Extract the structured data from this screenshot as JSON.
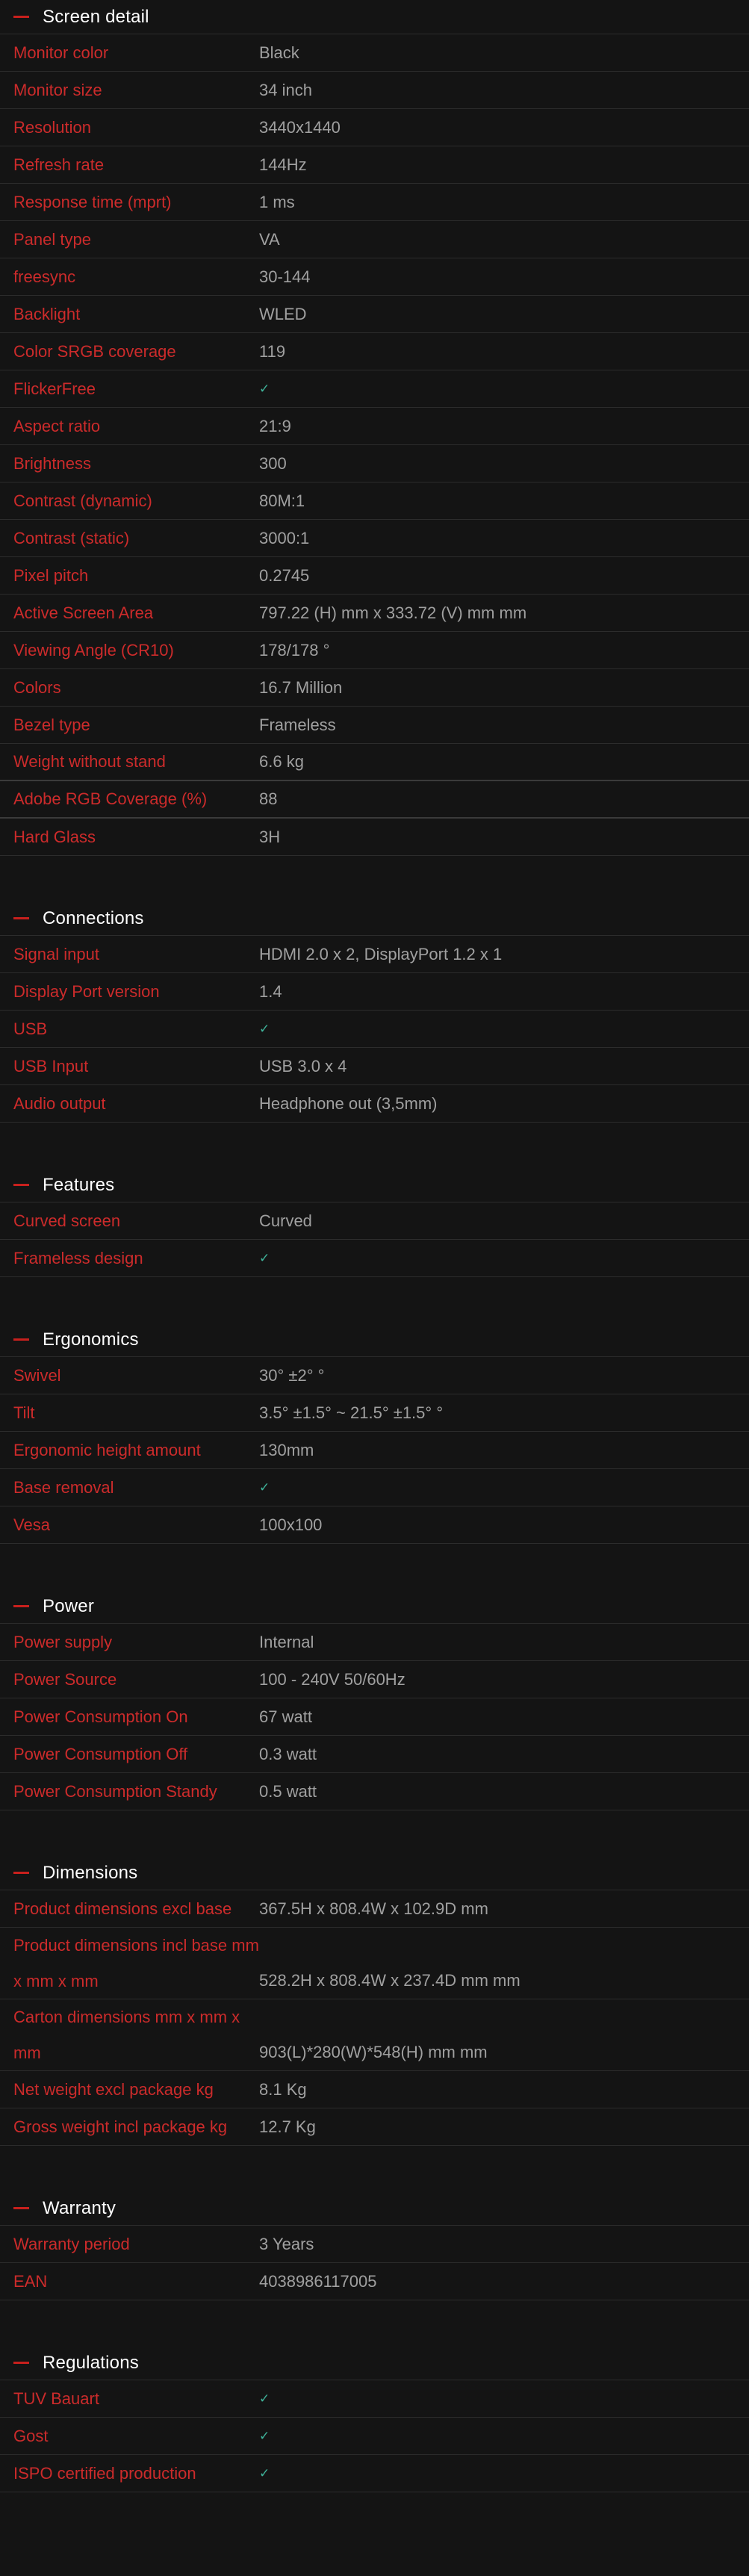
{
  "check_symbol": "✓",
  "colors": {
    "background": "#141414",
    "label": "#cc2b2b",
    "value": "#a0a0a0",
    "check": "#3fb39a",
    "accent_dash": "#c8201d"
  },
  "sections": [
    {
      "title": "Screen detail",
      "rows": [
        {
          "label": "Monitor color",
          "value": "Black"
        },
        {
          "label": "Monitor size",
          "value": "34 inch"
        },
        {
          "label": "Resolution",
          "value": "3440x1440"
        },
        {
          "label": "Refresh rate",
          "value": "144Hz"
        },
        {
          "label": "Response time (mprt)",
          "value": "1 ms"
        },
        {
          "label": "Panel type",
          "value": "VA"
        },
        {
          "label": "freesync",
          "value": "30-144"
        },
        {
          "label": "Backlight",
          "value": "WLED"
        },
        {
          "label": "Color SRGB coverage",
          "value": "119"
        },
        {
          "label": "FlickerFree",
          "check": true
        },
        {
          "label": "Aspect ratio",
          "value": "21:9"
        },
        {
          "label": "Brightness",
          "value": "300"
        },
        {
          "label": "Contrast (dynamic)",
          "value": "80M:1"
        },
        {
          "label": "Contrast (static)",
          "value": "3000:1"
        },
        {
          "label": "Pixel pitch",
          "value": "0.2745"
        },
        {
          "label": "Active Screen Area",
          "value": "797.22 (H) mm x 333.72 (V) mm mm"
        },
        {
          "label": "Viewing Angle (CR10)",
          "value": "178/178 °"
        },
        {
          "label": "Colors",
          "value": "16.7 Million"
        },
        {
          "label": "Bezel type",
          "value": "Frameless"
        },
        {
          "label": "Weight without stand",
          "value": "6.6 kg"
        },
        {
          "label": "Adobe RGB Coverage (%)",
          "value": "88"
        },
        {
          "label": "Hard Glass",
          "value": "3H"
        }
      ]
    },
    {
      "title": "Connections",
      "rows": [
        {
          "label": "Signal input",
          "value": "HDMI 2.0 x 2, DisplayPort 1.2 x 1"
        },
        {
          "label": "Display Port version",
          "value": "1.4"
        },
        {
          "label": "USB",
          "check": true
        },
        {
          "label": "USB Input",
          "value": "USB 3.0 x 4"
        },
        {
          "label": "Audio output",
          "value": "Headphone out (3,5mm)"
        }
      ]
    },
    {
      "title": "Features",
      "rows": [
        {
          "label": "Curved screen",
          "value": "Curved"
        },
        {
          "label": "Frameless design",
          "check": true
        }
      ]
    },
    {
      "title": "Ergonomics",
      "rows": [
        {
          "label": "Swivel",
          "value": "30° ±2° °"
        },
        {
          "label": "Tilt",
          "value": "3.5° ±1.5° ~ 21.5° ±1.5° °"
        },
        {
          "label": "Ergonomic height amount",
          "value": "130mm"
        },
        {
          "label": "Base removal",
          "check": true
        },
        {
          "label": "Vesa",
          "value": "100x100"
        }
      ]
    },
    {
      "title": "Power",
      "rows": [
        {
          "label": "Power supply",
          "value": "Internal"
        },
        {
          "label": "Power Source",
          "value": "100 - 240V 50/60Hz"
        },
        {
          "label": "Power Consumption On",
          "value": "67 watt"
        },
        {
          "label": "Power Consumption Off",
          "value": "0.3 watt"
        },
        {
          "label": "Power Consumption Standy",
          "value": "0.5 watt"
        }
      ]
    },
    {
      "title": "Dimensions",
      "rows": [
        {
          "label": "Product dimensions excl base",
          "value": "367.5H x 808.4W x 102.9D mm"
        },
        {
          "label": "Product dimensions incl base mm x mm x mm",
          "value": "528.2H x 808.4W x 237.4D mm mm",
          "tall": true
        },
        {
          "label": "Carton dimensions mm x mm x mm",
          "value": "903(L)*280(W)*548(H) mm mm",
          "tall": true
        },
        {
          "label": "Net weight excl package kg",
          "value": "8.1 Kg"
        },
        {
          "label": "Gross weight incl package kg",
          "value": "12.7 Kg"
        }
      ]
    },
    {
      "title": "Warranty",
      "rows": [
        {
          "label": "Warranty period",
          "value": "3 Years"
        },
        {
          "label": "EAN",
          "value": "4038986117005"
        }
      ]
    },
    {
      "title": "Regulations",
      "rows": [
        {
          "label": "TUV Bauart",
          "check": true
        },
        {
          "label": "Gost",
          "check": true
        },
        {
          "label": "ISPO certified production",
          "check": true
        }
      ]
    }
  ]
}
